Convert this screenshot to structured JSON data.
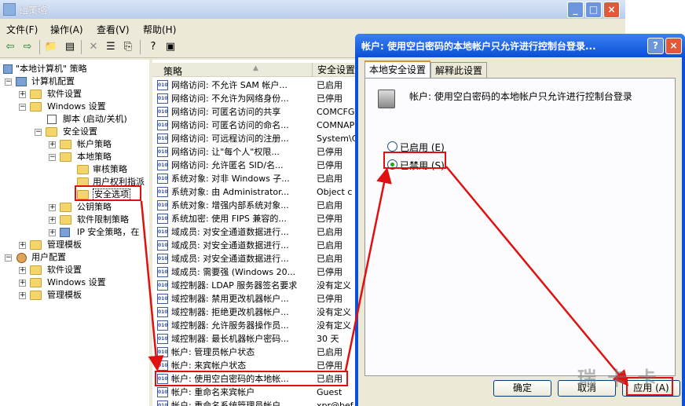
{
  "main_window": {
    "title": "组策略",
    "controls": [
      "_",
      "□",
      "×"
    ]
  },
  "menu": [
    "文件(F)",
    "操作(A)",
    "查看(V)",
    "帮助(H)"
  ],
  "toolbar_icons": [
    "back-icon",
    "forward-icon",
    "up-folder-icon",
    "show-hide-tree-icon",
    "delete-icon",
    "properties-icon",
    "export-icon",
    "help-icon",
    "help-topics-icon"
  ],
  "tree": [
    {
      "label": "\"本地计算机\" 策略"
    },
    {
      "label": "计算机配置"
    },
    {
      "label": "软件设置"
    },
    {
      "label": "Windows 设置"
    },
    {
      "label": "脚本 (启动/关机)"
    },
    {
      "label": "安全设置"
    },
    {
      "label": "帐户策略"
    },
    {
      "label": "本地策略"
    },
    {
      "label": "审核策略"
    },
    {
      "label": "用户权利指派"
    },
    {
      "label": "安全选项"
    },
    {
      "label": "公钥策略"
    },
    {
      "label": "软件限制策略"
    },
    {
      "label": "IP 安全策略，在"
    },
    {
      "label": "管理模板"
    },
    {
      "label": "用户配置"
    },
    {
      "label": "软件设置"
    },
    {
      "label": "Windows 设置"
    },
    {
      "label": "管理模板"
    }
  ],
  "list": {
    "columns": [
      "策略",
      "安全设置"
    ],
    "rows": [
      {
        "name": "网络访问: 不允许 SAM 帐户...",
        "value": "已启用"
      },
      {
        "name": "网络访问: 不允许为网络身份...",
        "value": "已停用"
      },
      {
        "name": "网络访问: 可匿名访问的共享",
        "value": "COMCFG,D"
      },
      {
        "name": "网络访问: 可匿名访问的命名...",
        "value": "COMNAP,C"
      },
      {
        "name": "网络访问: 可远程访问的注册...",
        "value": "System\\C"
      },
      {
        "name": "网络访问: 让\"每个人\"权限...",
        "value": "已停用"
      },
      {
        "name": "网络访问: 允许匿名 SID/名...",
        "value": "已停用"
      },
      {
        "name": "系统对象: 对非 Windows 子...",
        "value": "已启用"
      },
      {
        "name": "系统对象: 由 Administrator...",
        "value": "Object c"
      },
      {
        "name": "系统对象: 增强内部系统对象...",
        "value": "已启用"
      },
      {
        "name": "系统加密: 使用 FIPS 兼容的...",
        "value": "已停用"
      },
      {
        "name": "域成员: 对安全通道数据进行...",
        "value": "已启用"
      },
      {
        "name": "域成员: 对安全通道数据进行...",
        "value": "已启用"
      },
      {
        "name": "域成员: 对安全通道数据进行...",
        "value": "已启用"
      },
      {
        "name": "域成员: 需要强 (Windows 20...",
        "value": "已停用"
      },
      {
        "name": "域控制器: LDAP 服务器签名要求",
        "value": "没有定义"
      },
      {
        "name": "域控制器: 禁用更改机器帐户...",
        "value": "已停用"
      },
      {
        "name": "域控制器: 拒绝更改机器帐户...",
        "value": "没有定义"
      },
      {
        "name": "域控制器: 允许服务器操作员...",
        "value": "没有定义"
      },
      {
        "name": "域控制器: 最长机器帐户密码...",
        "value": "30 天"
      },
      {
        "name": "帐户: 管理员帐户状态",
        "value": "已启用"
      },
      {
        "name": "帐户: 来宾帐户状态",
        "value": "已停用"
      },
      {
        "name": "帐户: 使用空白密码的本地帐...",
        "value": "已启用"
      },
      {
        "name": "帐户: 重命名来宾帐户",
        "value": "Guest"
      },
      {
        "name": "帐户: 重命名系统管理员帐户",
        "value": "xpr@bef"
      }
    ]
  },
  "dialog": {
    "title": "帐户: 使用空白密码的本地帐户只允许进行控制台登录...",
    "help_btn": "?",
    "close_btn": "×",
    "tabs": [
      "本地安全设置",
      "解释此设置"
    ],
    "policy_text": "帐户: 使用空白密码的本地帐户只允许进行控制台登录",
    "radio_enabled": "已启用 (E)",
    "radio_disabled": "已禁用 (S)",
    "selected": "disabled",
    "ok": "确定",
    "cancel": "取消",
    "apply": "应用 (A)"
  },
  "watermark": "瑞 卡 卡"
}
